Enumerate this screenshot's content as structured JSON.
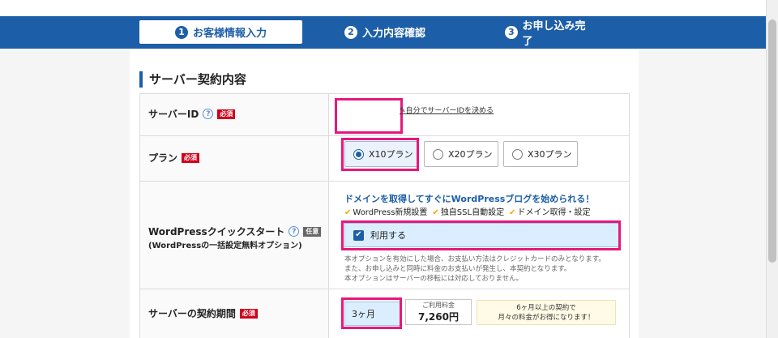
{
  "steps": [
    {
      "num": "1",
      "label": "お客様情報入力"
    },
    {
      "num": "2",
      "label": "入力内容確認"
    },
    {
      "num": "3",
      "label": "お申し込み完了"
    }
  ],
  "section": {
    "title": "サーバー契約内容"
  },
  "server_id": {
    "label": "サーバーID",
    "help": "?",
    "required": "必須",
    "link": "自分でサーバーIDを決める"
  },
  "plan": {
    "label": "プラン",
    "required": "必須",
    "options": [
      "X10プラン",
      "X20プラン",
      "X30プラン"
    ],
    "selected": "X10プラン"
  },
  "wordpress": {
    "label": "WordPressクイックスタート",
    "help": "?",
    "optional": "任意",
    "sublabel": "(WordPressの一括設定無料オプション)",
    "headline": "ドメインを取得してすぐにWordPressブログを始められる！",
    "features": [
      "WordPress新規設置",
      "独自SSL自動設定",
      "ドメイン取得・設定"
    ],
    "checkbox_label": "利用する",
    "checked": true,
    "notes": [
      "本オプションを有効にした場合、お支払い方法はクレジットカードのみとなります。",
      "また、お申し込みと同時に料金のお支払いが発生し、本契約となります。",
      "本オプションはサーバーの移転には対応しておりません。"
    ]
  },
  "period": {
    "label": "サーバーの契約期間",
    "required": "必須",
    "value": "3ヶ月",
    "fee_label": "ご利用料金",
    "fee_amount": "7,260円",
    "promo_line1": "6ヶ月以上の契約で",
    "promo_line2": "月々の料金がお得になります！"
  },
  "colors": {
    "brand": "#1d5ea8",
    "highlight": "#e6197a",
    "required": "#d0021b"
  }
}
